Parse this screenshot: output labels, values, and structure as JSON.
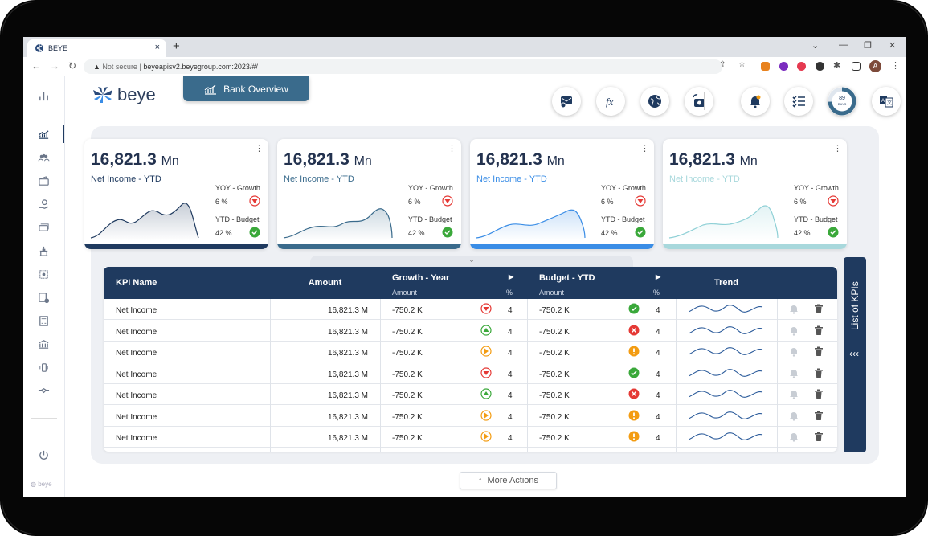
{
  "browser": {
    "tab_title": "BEYE",
    "new_tab_symbol": "+",
    "close_tab_symbol": "×",
    "not_secure": "Not secure",
    "url": "beyeapisv2.beyegroup.com:2023/#/",
    "avatar_letter": "A"
  },
  "app": {
    "logo_text": "beye",
    "page_button_label": "Bank Overview",
    "trial_days": "89",
    "trial_unit": "DAYS",
    "footer_logo": "beye"
  },
  "cards": [
    {
      "value": "16,821.3",
      "unit": "Mn",
      "label": "Net Income - YTD",
      "yoy_label": "YOY - Growth",
      "yoy_value": "6 %",
      "ytd_label": "YTD - Budget",
      "ytd_value": "42 %",
      "accent": "#1f3a5f",
      "label_color": "#1f3a5f"
    },
    {
      "value": "16,821.3",
      "unit": "Mn",
      "label": "Net Income - YTD",
      "yoy_label": "YOY - Growth",
      "yoy_value": "6 %",
      "ytd_label": "YTD - Budget",
      "ytd_value": "42 %",
      "accent": "#3a6b8c",
      "label_color": "#3a6b8c"
    },
    {
      "value": "16,821.3",
      "unit": "Mn",
      "label": "Net Income - YTD",
      "yoy_label": "YOY - Growth",
      "yoy_value": "6 %",
      "ytd_label": "YTD - Budget",
      "ytd_value": "42 %",
      "accent": "#3a8de6",
      "label_color": "#3a8de6"
    },
    {
      "value": "16,821.3",
      "unit": "Mn",
      "label": "Net Income - YTD",
      "yoy_label": "YOY - Growth",
      "yoy_value": "6 %",
      "ytd_label": "YTD - Budget",
      "ytd_value": "42 %",
      "accent": "#a8d8dc",
      "label_color": "#a8d8dc"
    }
  ],
  "table": {
    "headers": {
      "kpi": "KPI Name",
      "amount": "Amount",
      "growth": "Growth - Year",
      "growth_amount": "Amount",
      "growth_pct": "%",
      "budget": "Budget - YTD",
      "budget_amount": "Amount",
      "budget_pct": "%",
      "trend": "Trend"
    },
    "rows": [
      {
        "name": "Net Income",
        "amount": "16,821.3 M",
        "growth_amount": "-750.2 K",
        "growth_icon": "down",
        "growth_pct": "4",
        "budget_amount": "-750.2 K",
        "budget_icon": "check",
        "budget_pct": "4"
      },
      {
        "name": "Net Income",
        "amount": "16,821.3 M",
        "growth_amount": "-750.2 K",
        "growth_icon": "up",
        "growth_pct": "4",
        "budget_amount": "-750.2 K",
        "budget_icon": "cross",
        "budget_pct": "4"
      },
      {
        "name": "Net Income",
        "amount": "16,821.3 M",
        "growth_amount": "-750.2 K",
        "growth_icon": "right",
        "growth_pct": "4",
        "budget_amount": "-750.2 K",
        "budget_icon": "warn",
        "budget_pct": "4"
      },
      {
        "name": "Net Income",
        "amount": "16,821.3 M",
        "growth_amount": "-750.2 K",
        "growth_icon": "down",
        "growth_pct": "4",
        "budget_amount": "-750.2 K",
        "budget_icon": "check",
        "budget_pct": "4"
      },
      {
        "name": "Net Income",
        "amount": "16,821.3 M",
        "growth_amount": "-750.2 K",
        "growth_icon": "up",
        "growth_pct": "4",
        "budget_amount": "-750.2 K",
        "budget_icon": "cross",
        "budget_pct": "4"
      },
      {
        "name": "Net Income",
        "amount": "16,821.3 M",
        "growth_amount": "-750.2 K",
        "growth_icon": "right",
        "growth_pct": "4",
        "budget_amount": "-750.2 K",
        "budget_icon": "warn",
        "budget_pct": "4"
      },
      {
        "name": "Net Income",
        "amount": "16,821.3 M",
        "growth_amount": "-750.2 K",
        "growth_icon": "right",
        "growth_pct": "4",
        "budget_amount": "-750.2 K",
        "budget_icon": "warn",
        "budget_pct": "4"
      }
    ]
  },
  "side_panel": {
    "label": "List of KPIs",
    "toggle": "‹‹‹"
  },
  "more_actions": "More Actions",
  "colors": {
    "navy": "#1f3a5f",
    "green": "#3aa83a",
    "red": "#e53935",
    "orange": "#f39c12",
    "growth_down": "#e53935",
    "growth_up": "#3aa83a",
    "growth_right": "#f39c12"
  }
}
